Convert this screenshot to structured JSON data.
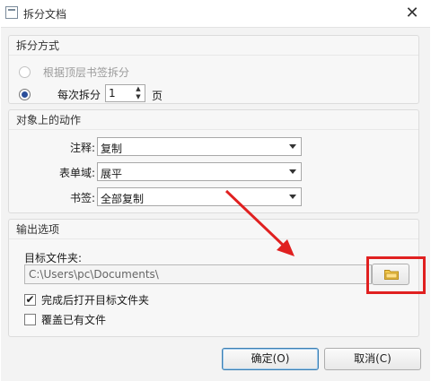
{
  "window": {
    "title": "拆分文档",
    "close_glyph": "✕"
  },
  "split_method": {
    "title": "拆分方式",
    "option_bookmark": "根据顶层书签拆分",
    "option_pages_prefix": "每次拆分",
    "pages_value": "1",
    "pages_suffix": "页"
  },
  "actions": {
    "title": "对象上的动作",
    "annotation_label": "注释:",
    "annotation_value": "复制",
    "form_label": "表单域:",
    "form_value": "展平",
    "bookmark_label": "书签:",
    "bookmark_value": "全部复制"
  },
  "output": {
    "title": "输出选项",
    "target_folder_label": "目标文件夹:",
    "target_folder_value": "C:\\Users\\pc\\Documents\\",
    "open_after_label": "完成后打开目标文件夹",
    "open_after_checked": "✔",
    "overwrite_label": "覆盖已有文件"
  },
  "buttons": {
    "ok": "确定(O)",
    "cancel": "取消(C)"
  },
  "icons": {
    "folder_browse": "folder-icon"
  }
}
